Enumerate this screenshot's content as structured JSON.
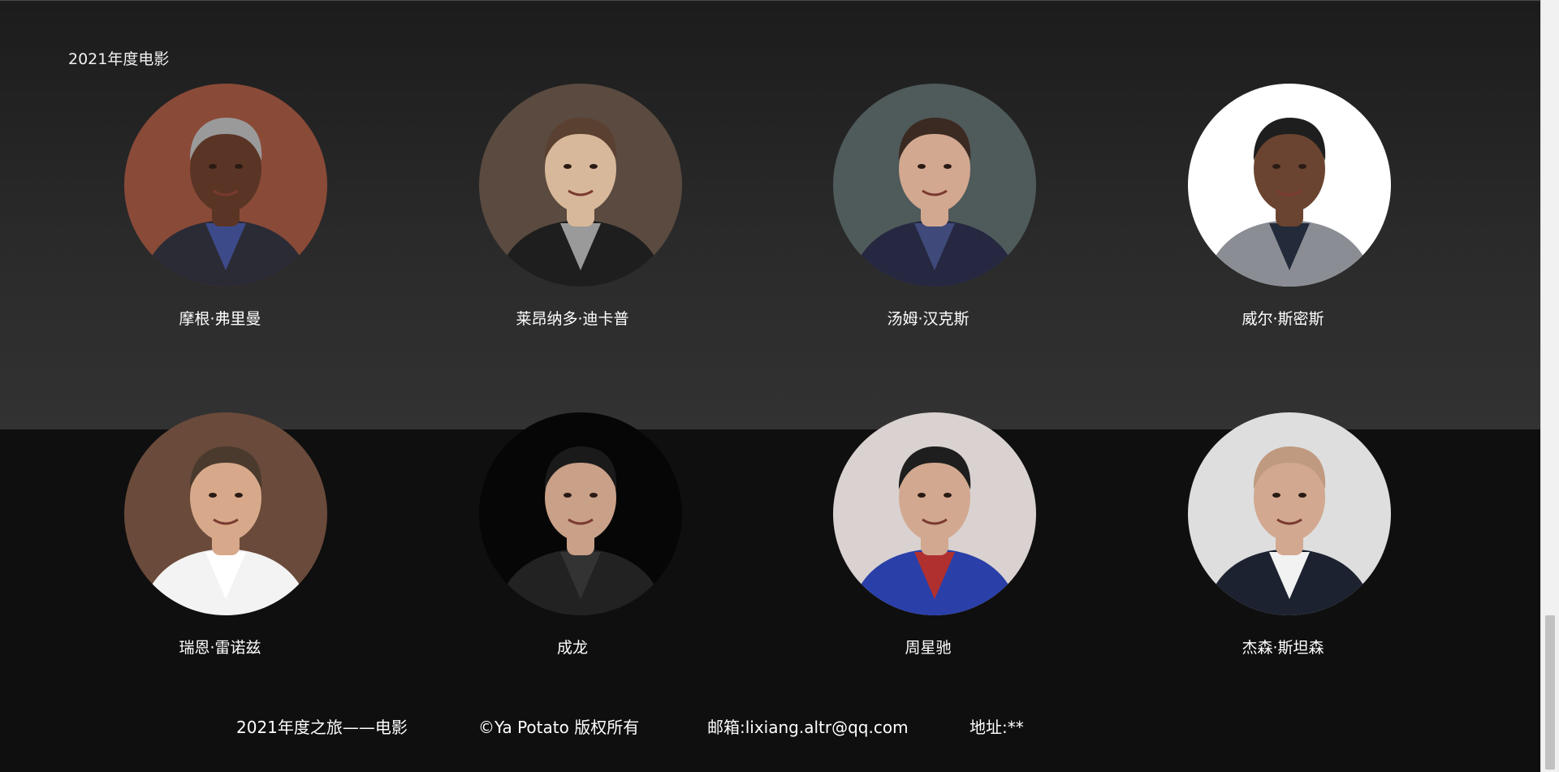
{
  "section": {
    "title": "2021年度电影"
  },
  "actors": [
    {
      "name": "摩根·弗里曼",
      "bg": "#8a4a38",
      "skin": "#5a3525",
      "hair": "#9a9a9a",
      "shirt": "#2b2b35",
      "collar": "#3d4a8a"
    },
    {
      "name": "莱昂纳多·迪卡普",
      "bg": "#5a4a3f",
      "skin": "#d8b89a",
      "hair": "#5a4030",
      "shirt": "#1e1e1e",
      "collar": "#9a9a9a"
    },
    {
      "name": "汤姆·汉克斯",
      "bg": "#4f5a5a",
      "skin": "#d3a890",
      "hair": "#3a2a22",
      "shirt": "#252840",
      "collar": "#3f4a7a"
    },
    {
      "name": "威尔·斯密斯",
      "bg": "#ffffff",
      "skin": "#6a4430",
      "hair": "#1e1e1e",
      "shirt": "#8a8e94",
      "collar": "#232a3a"
    },
    {
      "name": "瑞恩·雷诺兹",
      "bg": "#6a4a3a",
      "skin": "#d7a98a",
      "hair": "#4a3a2e",
      "shirt": "#f3f3f3",
      "collar": "#ffffff"
    },
    {
      "name": "成龙",
      "bg": "#060606",
      "skin": "#c9a088",
      "hair": "#1a1a1a",
      "shirt": "#222222",
      "collar": "#333333"
    },
    {
      "name": "周星驰",
      "bg": "#d9d2d0",
      "skin": "#d2a890",
      "hair": "#1e1e1e",
      "shirt": "#2a3fa8",
      "collar": "#b03030"
    },
    {
      "name": "杰森·斯坦森",
      "bg": "#dedede",
      "skin": "#d2a890",
      "hair": "#c09a80",
      "shirt": "#1c2230",
      "collar": "#f2f2f2"
    }
  ],
  "footer": {
    "title": "2021年度之旅——电影",
    "copyright": "©Ya Potato 版权所有",
    "email": "邮箱:lixiang.altr@qq.com",
    "address": "地址:**"
  }
}
